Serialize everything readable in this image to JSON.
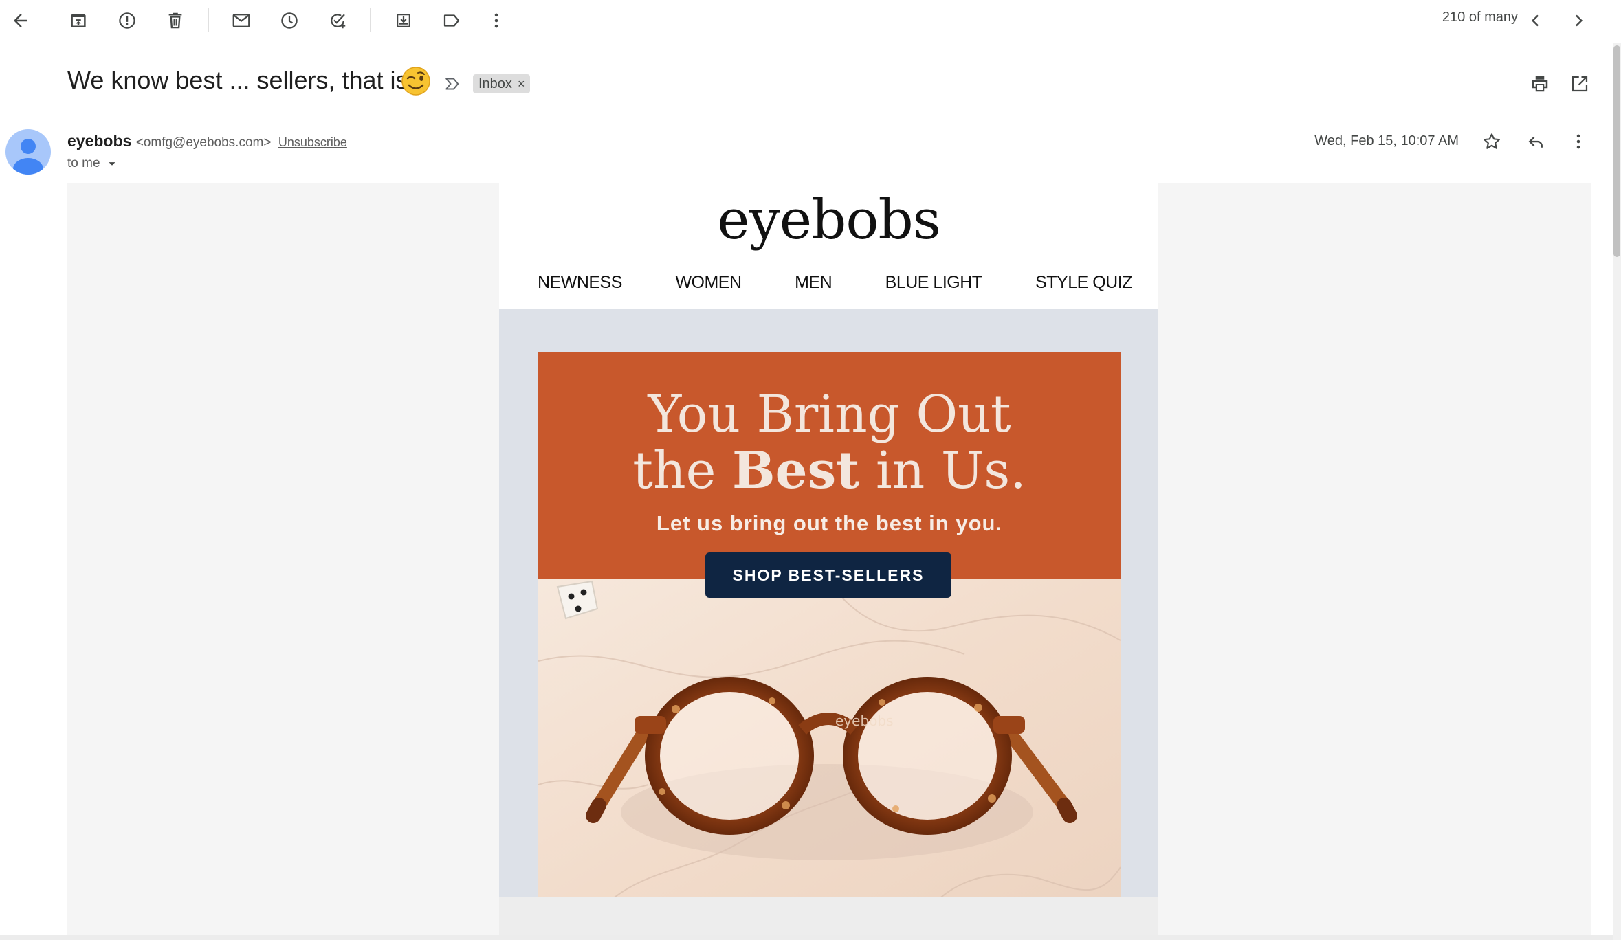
{
  "toolbar": {
    "icons": [
      "back-arrow-icon",
      "archive-icon",
      "report-spam-icon",
      "delete-icon",
      "mark-unread-icon",
      "snooze-icon",
      "add-to-tasks-icon",
      "move-to-icon",
      "label-icon",
      "more-vert-icon"
    ],
    "counter": "210 of many",
    "nav_icons": [
      "chevron-left-icon",
      "chevron-right-icon"
    ]
  },
  "message": {
    "subject": "We know best ... sellers, that is",
    "subject_emoji": "wink-emoji",
    "label_chip": "Inbox",
    "label_chip_close": "×",
    "actions": [
      "print-icon",
      "open-in-new-window-icon"
    ]
  },
  "sender": {
    "name": "eyebobs",
    "email": "<omfg@eyebobs.com>",
    "unsubscribe": "Unsubscribe",
    "recipient": "to me",
    "date": "Wed, Feb 15, 10:07 AM",
    "actions": [
      "star-icon",
      "reply-icon",
      "more-vert-icon"
    ]
  },
  "email": {
    "logo": "eyebobs",
    "nav": [
      "NEWNESS",
      "WOMEN",
      "MEN",
      "BLUE LIGHT",
      "STYLE QUIZ"
    ],
    "hero": {
      "headline_line1": "You Bring Out",
      "headline_line2_pre": "the ",
      "headline_line2_bold": "Best",
      "headline_line2_post": " in Us.",
      "subhead": "Let us bring out the best in you.",
      "cta": "SHOP BEST-SELLERS",
      "photo_subject": "tortoiseshell round eyeglasses on marble with a die",
      "glasses_temple_text": "eyebobs"
    },
    "colors": {
      "banner_bg": "#c8582c",
      "cta_bg": "#0f2542",
      "hero_frame_bg": "#dde1e8",
      "canvas_bg": "#f5f5f5"
    }
  }
}
